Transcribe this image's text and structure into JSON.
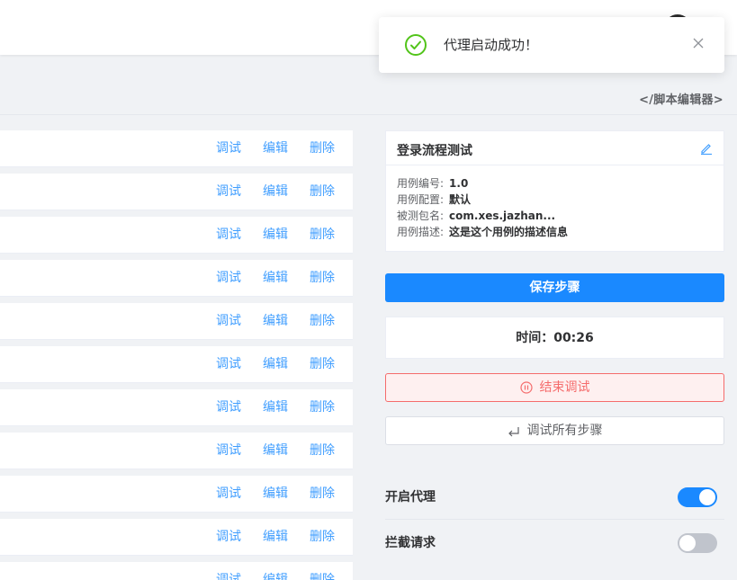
{
  "toast": {
    "message": "代理启动成功！"
  },
  "header": {
    "editor_link": "</脚本编辑器>"
  },
  "step_actions": {
    "debug": "调试",
    "edit": "编辑",
    "delete": "删除"
  },
  "steps_visible_count": 11,
  "case_card": {
    "title": "登录流程测试",
    "fields": [
      {
        "label": "用例编号:",
        "value": "1.0"
      },
      {
        "label": "用例配置:",
        "value": "默认"
      },
      {
        "label": "被测包名:",
        "value": "com.xes.jazhan..."
      },
      {
        "label": "用例描述:",
        "value": "这是这个用例的描述信息"
      }
    ]
  },
  "buttons": {
    "save": "保存步骤",
    "stop": "结束调试",
    "run_all": "调试所有步骤"
  },
  "timer": {
    "text": "时间：00:26"
  },
  "settings": [
    {
      "label": "开启代理",
      "enabled": true
    },
    {
      "label": "拦截请求",
      "enabled": false
    }
  ],
  "colors": {
    "primary": "#1a89ff",
    "link": "#409eff",
    "danger": "#f56c6c",
    "success": "#52c41a"
  }
}
